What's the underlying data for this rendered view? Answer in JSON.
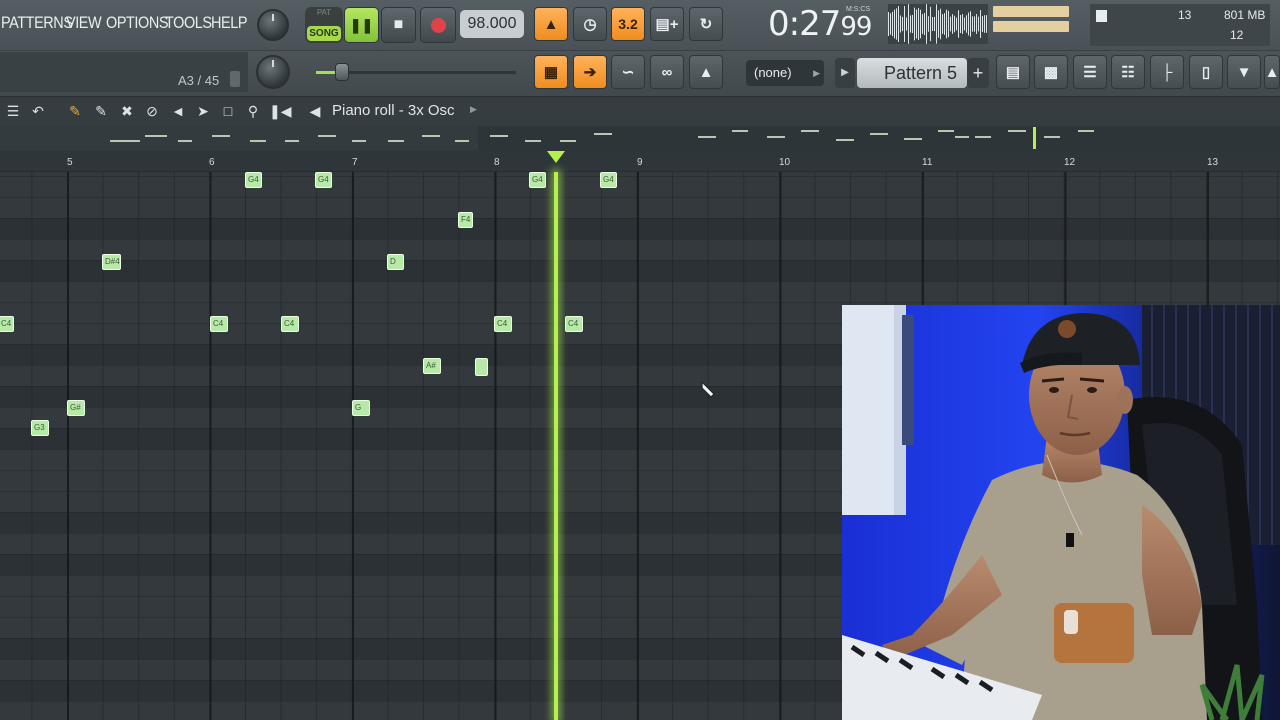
{
  "menu": {
    "patterns": "PATTERNS",
    "view": "VIEW",
    "options": "OPTIONS",
    "tools": "TOOLS",
    "help": "HELP"
  },
  "transport": {
    "pat_label": "PAT",
    "song_label": "SONG",
    "play_state": "pause",
    "tempo": "98.000"
  },
  "toolbar_icons": [
    "metronome-icon",
    "wait-for-input-icon",
    "countdown-icon",
    "step-edit-icon",
    "loop-record-icon"
  ],
  "countdown_label": "3.2",
  "clock": {
    "main": "0:27",
    "sub": "99",
    "unit": "M:S:CS"
  },
  "cpu": {
    "value": "13",
    "memory": "801 MB",
    "polyphony": "12"
  },
  "hint": {
    "text": "A3 / 45"
  },
  "volume_level": 0.13,
  "pattern_bar": {
    "dropdown": "(none)",
    "pattern": "Pattern 5",
    "add": "+"
  },
  "piano_roll": {
    "title": "Piano roll - 3x Osc"
  },
  "bars": [
    {
      "label": "5"
    },
    {
      "label": "6"
    },
    {
      "label": "7"
    },
    {
      "label": "8"
    },
    {
      "label": "9"
    },
    {
      "label": "10"
    },
    {
      "label": "11"
    },
    {
      "label": "12"
    },
    {
      "label": "13"
    }
  ],
  "notes": [
    {
      "label": "G4"
    },
    {
      "label": "G4"
    },
    {
      "label": "G4"
    },
    {
      "label": "G4"
    },
    {
      "label": "F4"
    },
    {
      "label": "D#4"
    },
    {
      "label": "D"
    },
    {
      "label": "C4"
    },
    {
      "label": "C4"
    },
    {
      "label": "C4"
    },
    {
      "label": "C4"
    },
    {
      "label": "C4"
    },
    {
      "label": "A#"
    },
    {
      "label": ""
    },
    {
      "label": "G#"
    },
    {
      "label": "G"
    },
    {
      "label": "G3"
    }
  ],
  "colors": {
    "accent_green": "#b5f04c",
    "note_fill": "#b7e9a8",
    "orange": "#f08c20"
  }
}
